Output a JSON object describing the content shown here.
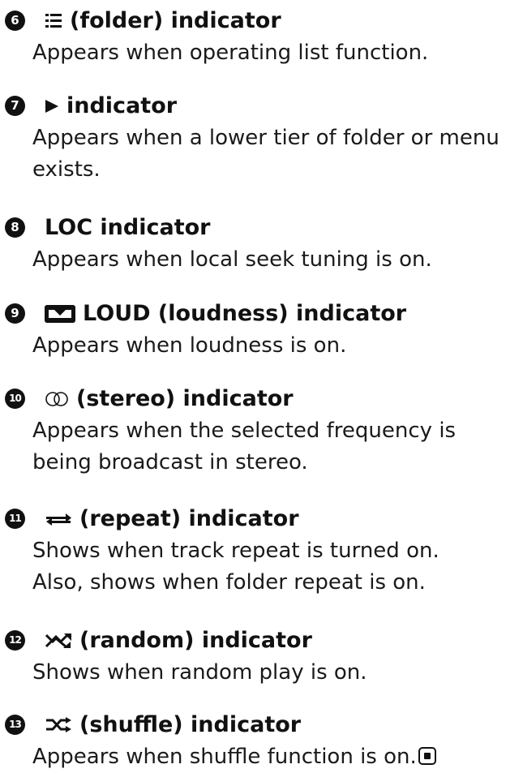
{
  "items": [
    {
      "number": "6",
      "title": "(folder) indicator",
      "icon": "folder-list-icon",
      "lines": [
        "Appears when operating list function."
      ]
    },
    {
      "number": "7",
      "title": "indicator",
      "icon": "triangle-right-icon",
      "lines": [
        "Appears when a lower tier of folder or menu",
        "exists."
      ]
    },
    {
      "number": "8",
      "title": "LOC indicator",
      "icon": "",
      "lines": [
        "Appears when local seek tuning is on."
      ]
    },
    {
      "number": "9",
      "title": "LOUD (loudness) indicator",
      "icon": "loudness-icon",
      "lines": [
        "Appears when loudness is on."
      ]
    },
    {
      "number": "10",
      "title": "(stereo) indicator",
      "icon": "stereo-icon",
      "lines": [
        "Appears when the selected frequency is",
        "being broadcast in stereo."
      ]
    },
    {
      "number": "11",
      "title": "(repeat) indicator",
      "icon": "repeat-icon",
      "lines": [
        "Shows when track repeat is turned on.",
        "Also, shows when folder repeat is on."
      ]
    },
    {
      "number": "12",
      "title": "(random) indicator",
      "icon": "random-icon",
      "lines": [
        "Shows when random play is on."
      ]
    },
    {
      "number": "13",
      "title": "(shuffle) indicator",
      "icon": "shuffle-icon",
      "lines": [
        "Appears when shuffle function is on."
      ]
    }
  ],
  "end_mark_icon": "stop-square-icon"
}
